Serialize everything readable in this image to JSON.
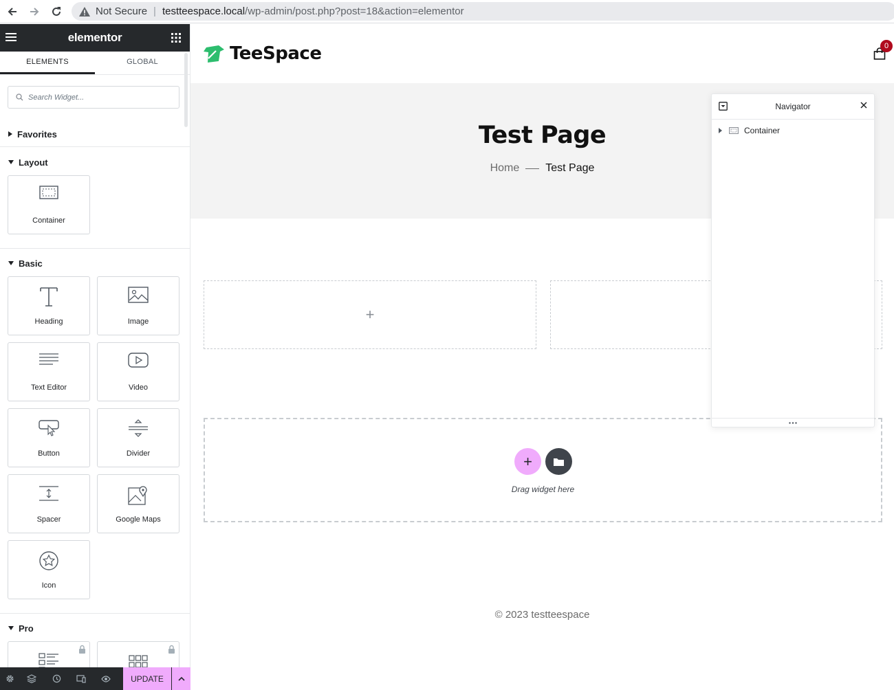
{
  "browser": {
    "security": "Not Secure",
    "url_host": "testteespace.local",
    "url_path": "/wp-admin/post.php?post=18&action=elementor"
  },
  "panel": {
    "logo": "elementor",
    "tabs": [
      "ELEMENTS",
      "GLOBAL"
    ],
    "search_placeholder": "Search Widget...",
    "categories": {
      "favorites": "Favorites",
      "layout": "Layout",
      "basic": "Basic",
      "pro": "Pro"
    },
    "layout_widgets": [
      {
        "label": "Container",
        "icon": "container-icon"
      }
    ],
    "basic_widgets": [
      {
        "label": "Heading",
        "icon": "heading-icon"
      },
      {
        "label": "Image",
        "icon": "image-icon"
      },
      {
        "label": "Text Editor",
        "icon": "text-editor-icon"
      },
      {
        "label": "Video",
        "icon": "video-icon"
      },
      {
        "label": "Button",
        "icon": "button-icon"
      },
      {
        "label": "Divider",
        "icon": "divider-icon"
      },
      {
        "label": "Spacer",
        "icon": "spacer-icon"
      },
      {
        "label": "Google Maps",
        "icon": "google-maps-icon"
      },
      {
        "label": "Icon",
        "icon": "star-icon"
      }
    ],
    "footer": {
      "update_label": "UPDATE"
    }
  },
  "site": {
    "name": "TeeSpace",
    "cart_count": "0",
    "page_title": "Test Page",
    "breadcrumb_home": "Home",
    "breadcrumb_current": "Test Page",
    "drop_hint": "Drag widget here",
    "copyright": "© 2023 testteespace"
  },
  "navigator": {
    "title": "Navigator",
    "items": [
      {
        "label": "Container"
      }
    ]
  },
  "colors": {
    "accent": "#f0abfc",
    "panel_dark": "#26292c",
    "logo_green": "#2dbd6e",
    "cart_badge": "#b00b1e"
  }
}
